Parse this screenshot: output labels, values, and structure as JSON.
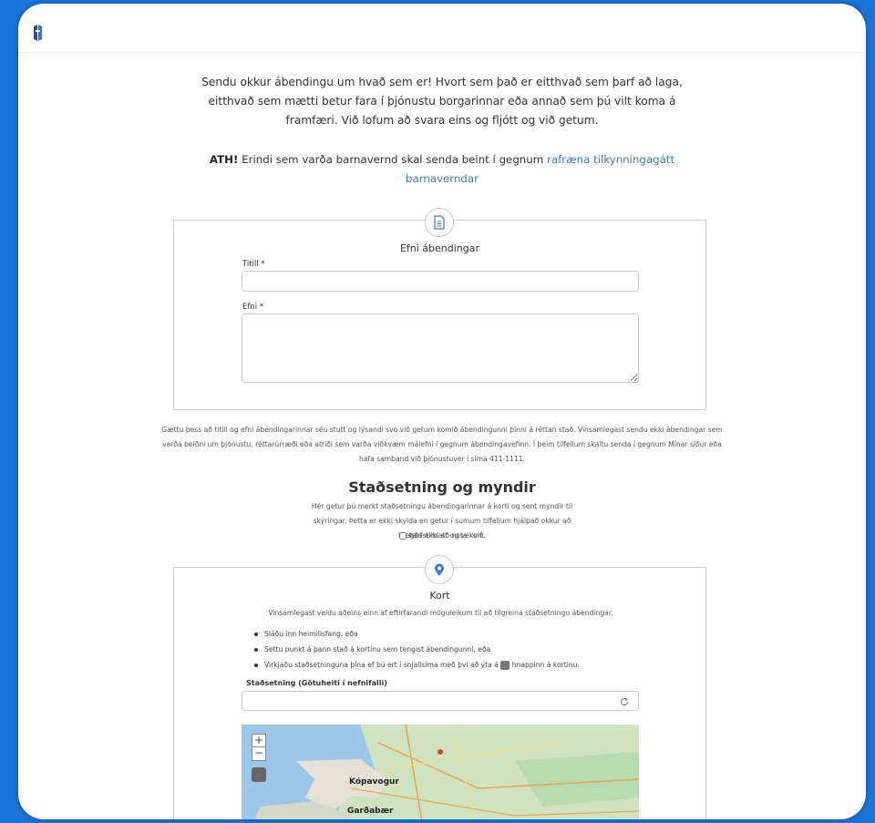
{
  "intro": "Sendu okkur ábendingu um hvað sem er! Hvort sem það er eitthvað sem þarf að laga, eitthvað sem mætti betur fara í þjónustu borgarinnar eða annað sem þú vilt koma á framfæri. Við lofum að svara eins og fljótt og við getum.",
  "notice": {
    "bold": "ATH!",
    "text": " Erindi sem varða barnavernd skal senda beint í gegnum ",
    "link": "rafræna tilkynningagátt barnaverndar"
  },
  "section1": {
    "icon": "document-icon",
    "title": "Efni ábendingar",
    "title_label": "Titill *",
    "title_value": "",
    "body_label": "Efni *",
    "body_value": ""
  },
  "guidance": "Gættu þess að titill og efni ábendingarinnar séu stutt og lýsandi svo við getum komið ábendingunni þinni á réttan stað. Vinsamlegast sendu ekki ábendingar sem varða beiðni um þjónustu, réttarúrræði eða atriði sem varða viðkvæm málefni í gegnum ábendingavefinn. Í þeim tilfellum skaltu senda í gegnum Mínar síður eða hafa samband við þjónustuver í síma 411-1111.",
  "location": {
    "heading": "Staðsetning og myndir",
    "desc": "Hér getur þú merkt staðsetningu ábendingarinnar á korti og sent myndir til skýringar. Þetta er ekki skylda en getur í sumum tilfellum hjálpað okkur að bregðast hratt og vel við.",
    "no_map_label": "Þarf ekki að nota kort.",
    "no_map_checked": false
  },
  "section2": {
    "icon": "map-pin-icon",
    "title": "Kort",
    "instruction": "Vinsamlegast veldu aðeins einn af eftirfarandi möguleikum til að tilgreina staðsetningu ábendingar.",
    "options": [
      "Sláðu inn heimilisfang, eða",
      "Settu punkt á þann stað á kortinu sem tengist ábendingunni, eða"
    ],
    "option3_before": "Virkjaðu staðsetninguna þína ef þú ert í snjallsíma með því að ýta á",
    "option3_after": "hnappinn á kortinu.",
    "address_label": "Staðsetning (Götuheiti í nefnifalli)",
    "address_value": "",
    "map_places": [
      "Kópavogur",
      "Garðabær"
    ],
    "zoom_in": "+",
    "zoom_out": "−"
  },
  "colors": {
    "background": "#1a74d8",
    "link": "#3a7ccc",
    "icon": "#3a7ccc"
  }
}
